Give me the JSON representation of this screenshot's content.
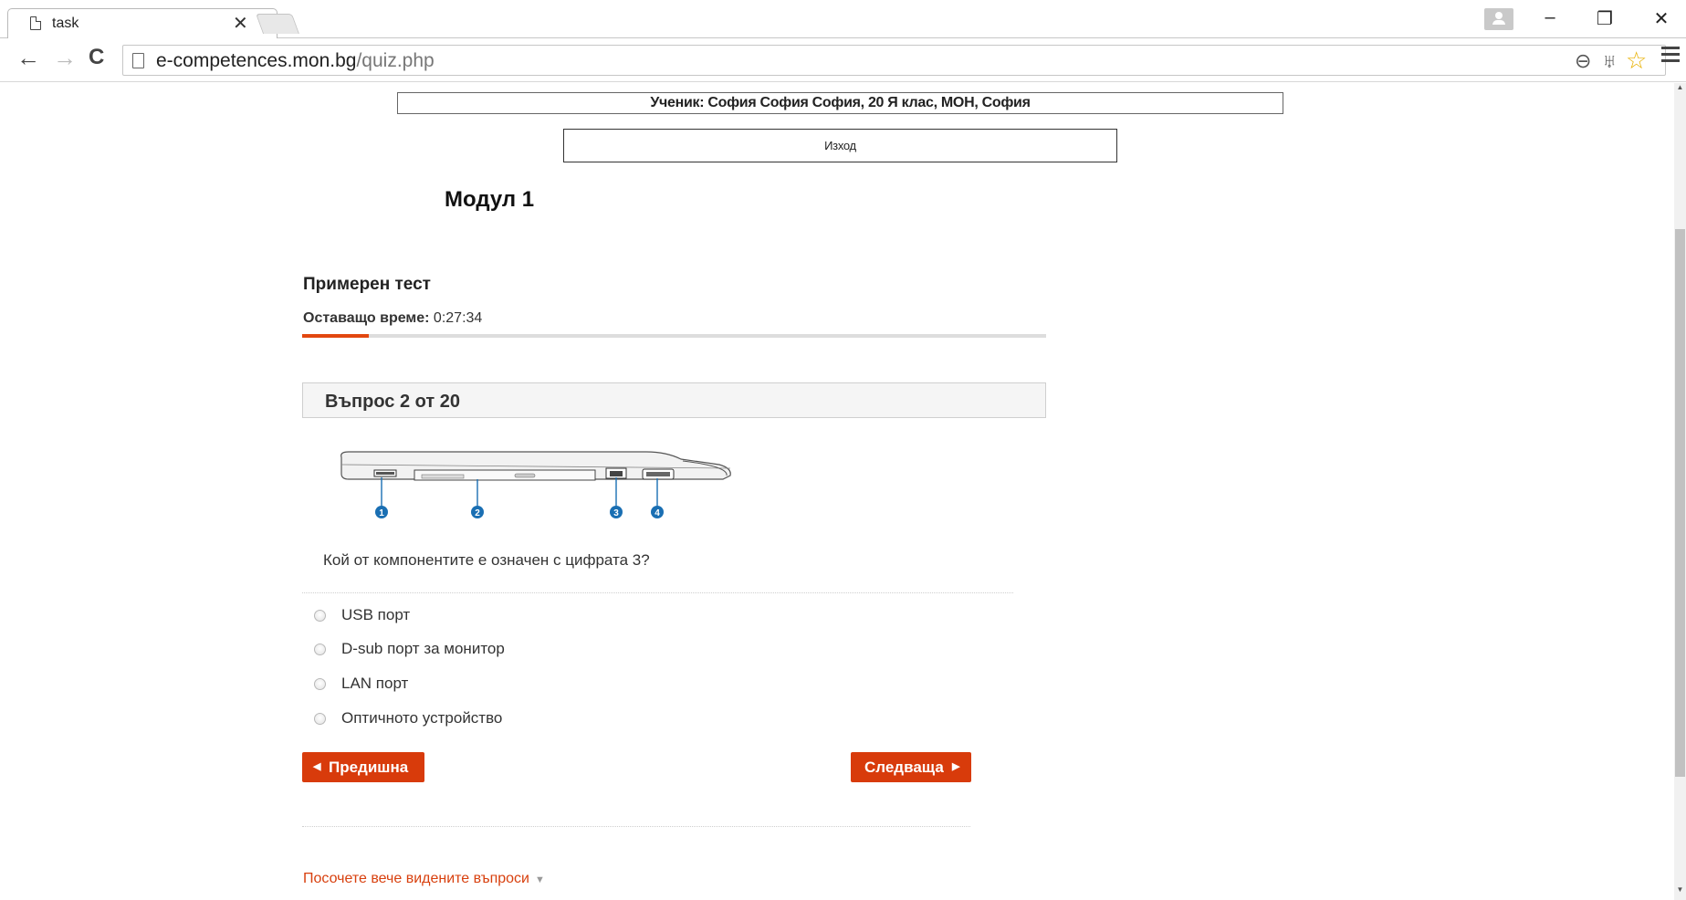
{
  "browser": {
    "tab_title": "task",
    "tab_close": "✕",
    "url_host": "e-competences.mon.bg",
    "url_path": "/quiz.php",
    "window_minimize": "–",
    "window_restore": "❐",
    "window_close": "✕",
    "back": "←",
    "forward": "→",
    "reload": "C",
    "zoom_icon": "⊖",
    "key_icon": "♅",
    "star_icon": "☆"
  },
  "page": {
    "student_info": "Ученик: София София София, 20 Я клас, МОН, София",
    "logout_label": "Изход",
    "module_title": "Модул 1",
    "test_title": "Примерен тест",
    "timer_label": "Оставащо време:",
    "timer_value": "0:27:34",
    "progress_fraction": 0.09,
    "question_counter": "Въпрос 2 от 20",
    "question_text": "Кой от компонентите е означен с цифрата 3?",
    "image_markers": [
      "1",
      "2",
      "3",
      "4"
    ],
    "options": [
      {
        "label": "USB порт",
        "selected": false
      },
      {
        "label": "D-sub порт за монитор",
        "selected": false
      },
      {
        "label": "LAN порт",
        "selected": false
      },
      {
        "label": "Оптичното устройство",
        "selected": false
      }
    ],
    "prev_button": "Предишна",
    "next_button": "Следваща",
    "review_link": "Посочете вече видените въпроси",
    "accent_color": "#d83b0b"
  }
}
